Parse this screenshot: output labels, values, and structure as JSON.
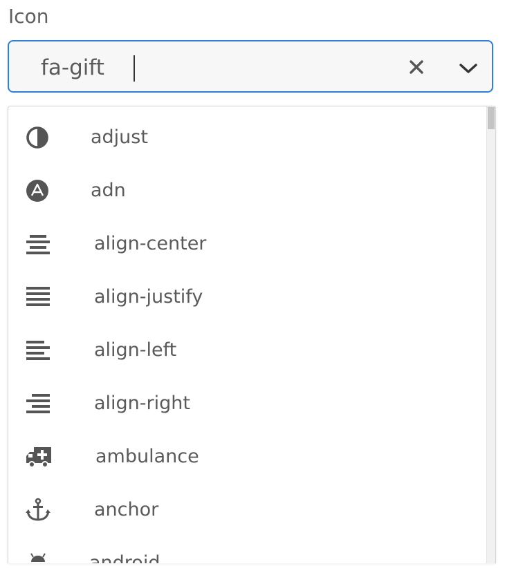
{
  "field": {
    "label": "Icon",
    "value": "fa-gift",
    "clear_icon": "close-icon",
    "toggle_icon": "chevron-down-icon",
    "accent_color": "#2f7fd6"
  },
  "dropdown": {
    "options": [
      {
        "icon": "adjust-icon",
        "label": "adjust"
      },
      {
        "icon": "adn-icon",
        "label": "adn"
      },
      {
        "icon": "align-center-icon",
        "label": "align-center"
      },
      {
        "icon": "align-justify-icon",
        "label": "align-justify"
      },
      {
        "icon": "align-left-icon",
        "label": "align-left"
      },
      {
        "icon": "align-right-icon",
        "label": "align-right"
      },
      {
        "icon": "ambulance-icon",
        "label": "ambulance"
      },
      {
        "icon": "anchor-icon",
        "label": "anchor"
      },
      {
        "icon": "android-icon",
        "label": "android"
      }
    ]
  }
}
